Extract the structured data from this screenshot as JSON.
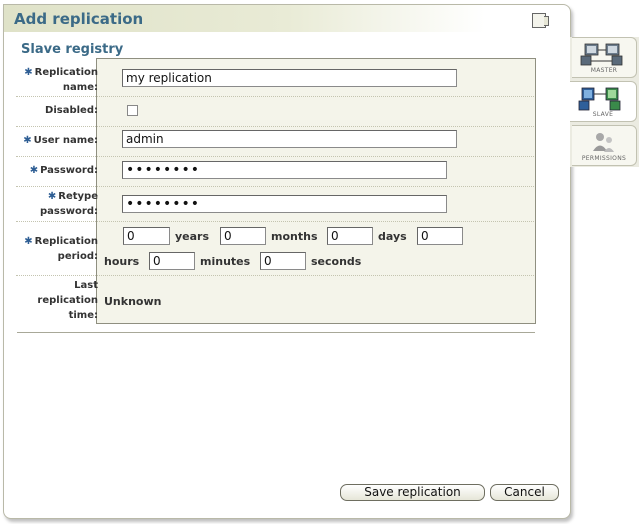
{
  "dialog": {
    "title": "Add replication",
    "section_title": "Slave registry"
  },
  "form": {
    "replication_name": {
      "label_line1": "Replication",
      "label_line2": "name:",
      "required": true,
      "value": "my replication"
    },
    "disabled": {
      "label": "Disabled:",
      "checked": false
    },
    "user_name": {
      "label": "User name:",
      "required": true,
      "value": "admin"
    },
    "password": {
      "label": "Password:",
      "required": true,
      "value": "••••••••"
    },
    "retype_password": {
      "label_line1": "Retype",
      "label_line2": "password:",
      "required": true,
      "value": "••••••••"
    },
    "replication_period": {
      "label_line1": "Replication",
      "label_line2": "period:",
      "required": true,
      "years": "0",
      "years_label": "years",
      "months": "0",
      "months_label": "months",
      "days": "0",
      "days_label": "days",
      "hours": "0",
      "hours_label": "hours",
      "minutes": "0",
      "minutes_label": "minutes",
      "seconds": "0",
      "seconds_label": "seconds"
    },
    "last_replication": {
      "label_line1": "Last",
      "label_line2": "replication",
      "label_line3": "time:",
      "value": "Unknown"
    },
    "required_marker": "✱"
  },
  "buttons": {
    "save": "Save replication",
    "cancel": "Cancel"
  },
  "tabs": [
    {
      "label": "MASTER",
      "active": false
    },
    {
      "label": "SLAVE",
      "active": true
    },
    {
      "label": "PERMISSIONS",
      "active": false
    }
  ],
  "colors": {
    "accent": "#3b6a87",
    "form_bg": "#f4f4ea",
    "required_star": "#2e5e94"
  }
}
